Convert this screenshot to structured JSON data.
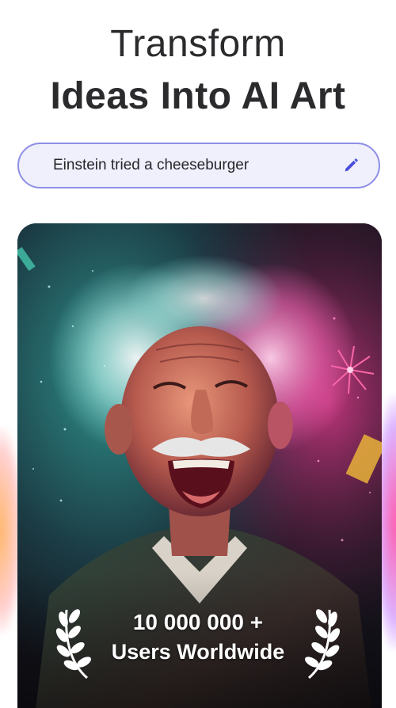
{
  "headline": {
    "line1": "Transform",
    "line2": "Ideas Into AI Art"
  },
  "prompt": {
    "value": "Einstein tried a cheeseburger",
    "edit_icon": "pencil-icon",
    "border_color": "#8d8fe6",
    "background_color": "#eff0fc"
  },
  "stats": {
    "count": "10 000 000 +",
    "caption": "Users Worldwide",
    "icon": "laurel-wreath-icon"
  }
}
